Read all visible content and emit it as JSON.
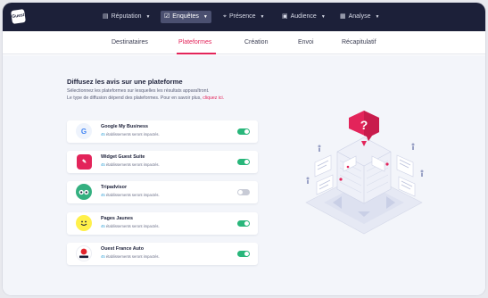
{
  "logo_text": "Guest",
  "nav": {
    "items": [
      {
        "label": "Réputation",
        "icon": "message-icon",
        "active": false
      },
      {
        "label": "Enquêtes",
        "icon": "survey-icon",
        "active": true
      },
      {
        "label": "Présence",
        "icon": "location-pin-icon",
        "active": false
      },
      {
        "label": "Audience",
        "icon": "audience-icon",
        "active": false
      },
      {
        "label": "Analyse",
        "icon": "chart-icon",
        "active": false
      }
    ]
  },
  "subtabs": {
    "items": [
      "Destinataires",
      "Plateformes",
      "Création",
      "Envoi",
      "Récapitulatif"
    ],
    "active": "Plateformes"
  },
  "main": {
    "title": "Diffusez les avis sur une plateforme",
    "desc_line1": "Sélectionnez les plateformes sur lesquelles les résultats apparaîtront.",
    "desc_line2": "Le type de diffusion dépend des plateformes. Pour en savoir plus,",
    "desc_link": "cliquez ici.",
    "platforms": [
      {
        "name": "Google My Business",
        "count": "45",
        "sub": "établissements seront impactés.",
        "enabled": true
      },
      {
        "name": "Widget Guest Suite",
        "count": "45",
        "sub": "établissements seront impactés.",
        "enabled": true
      },
      {
        "name": "Tripadvisor",
        "count": "45",
        "sub": "établissements seront impactés.",
        "enabled": false
      },
      {
        "name": "Pages Jaunes",
        "count": "45",
        "sub": "établissements seront impactés.",
        "enabled": true
      },
      {
        "name": "Ouest France Auto",
        "count": "45",
        "sub": "établissements seront impactés.",
        "enabled": true
      }
    ],
    "illustration_glyph": "?"
  },
  "colors": {
    "nav_bg": "#1c2039",
    "accent": "#e3245a",
    "toggle_on": "#28b67a",
    "content_bg": "#f3f5fa"
  }
}
